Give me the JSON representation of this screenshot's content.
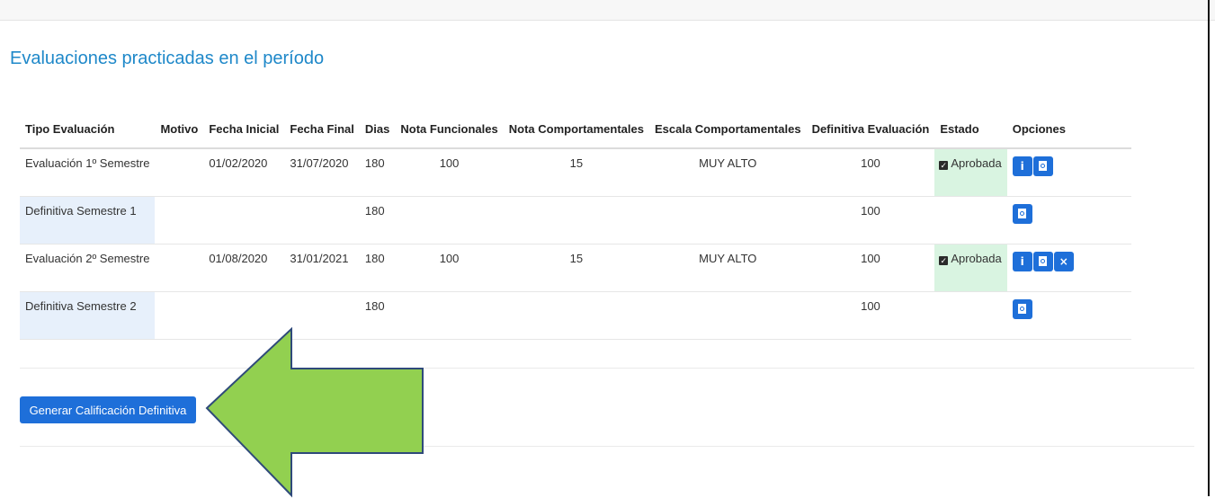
{
  "title": "Evaluaciones practicadas en el período",
  "table": {
    "headers": {
      "tipo": "Tipo Evaluación",
      "motivo": "Motivo",
      "fecha_inicial": "Fecha Inicial",
      "fecha_final": "Fecha Final",
      "dias": "Dias",
      "nota_funcionales": "Nota Funcionales",
      "nota_comportamentales": "Nota Comportamentales",
      "escala_comportamentales": "Escala Comportamentales",
      "definitiva": "Definitiva Evaluación",
      "estado": "Estado",
      "opciones": "Opciones"
    },
    "rows": [
      {
        "tipo": "Evaluación 1º Semestre",
        "motivo": "",
        "fecha_inicial": "01/02/2020",
        "fecha_final": "31/07/2020",
        "dias": "180",
        "nota_funcionales": "100",
        "nota_comportamentales": "15",
        "escala": "MUY ALTO",
        "definitiva": "100",
        "estado": "Aprobada"
      },
      {
        "tipo": "Definitiva Semestre 1",
        "dias": "180",
        "definitiva": "100"
      },
      {
        "tipo": "Evaluación 2º Semestre",
        "motivo": "",
        "fecha_inicial": "01/08/2020",
        "fecha_final": "31/01/2021",
        "dias": "180",
        "nota_funcionales": "100",
        "nota_comportamentales": "15",
        "escala": "MUY ALTO",
        "definitiva": "100",
        "estado": "Aprobada"
      },
      {
        "tipo": "Definitiva Semestre 2",
        "dias": "180",
        "definitiva": "100"
      }
    ]
  },
  "icons": {
    "info": "info-icon",
    "pdf": "pdf-file-icon",
    "delete": "close-icon",
    "check": "checkbox-checked-icon",
    "info_glyph": "i",
    "delete_glyph": "×",
    "check_glyph": "✓"
  },
  "generate_button_label": "Generar Calificación Definitiva",
  "colors": {
    "title": "#1e88c9",
    "button": "#1e6fd9",
    "approved_bg": "#d9f4e1",
    "definitive_bg": "#e7f0fb",
    "arrow_fill": "#92d050",
    "arrow_stroke": "#2f4a7a"
  }
}
